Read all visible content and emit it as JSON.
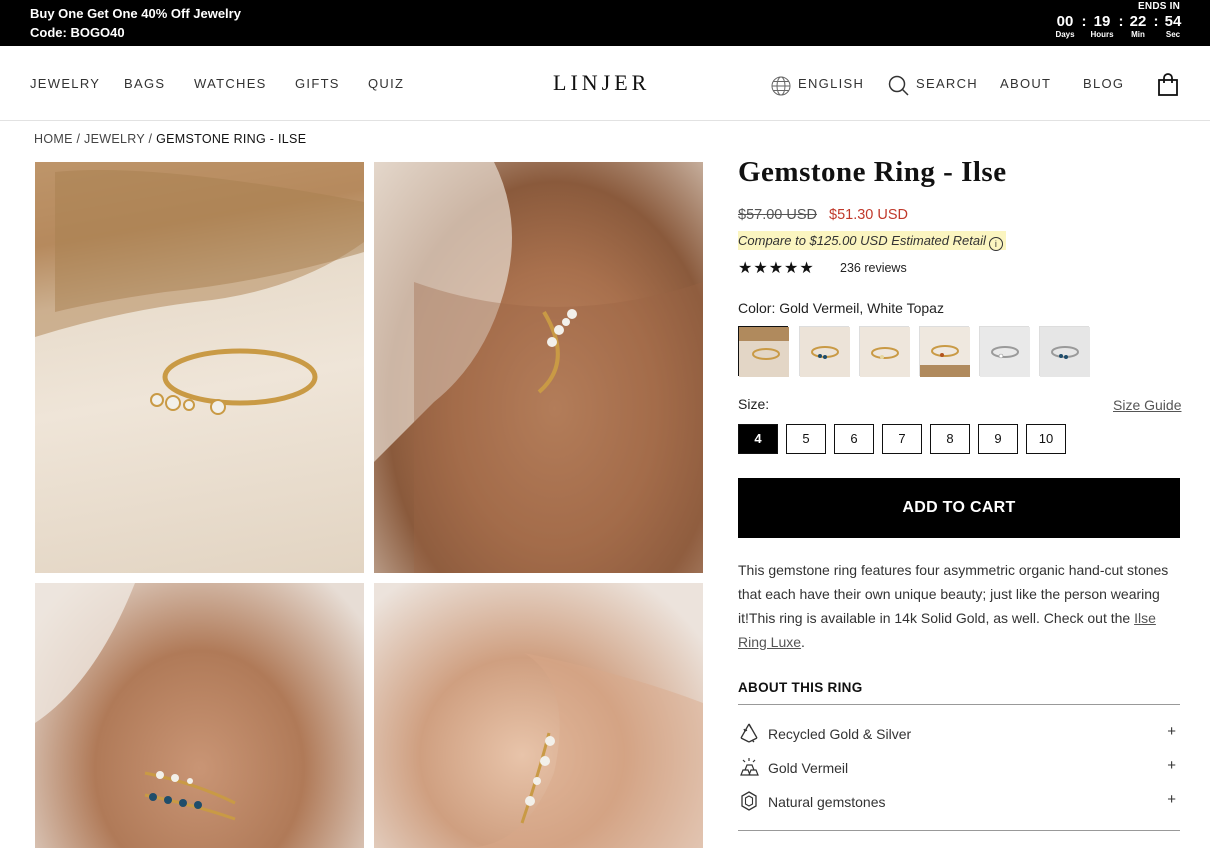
{
  "promo": {
    "line1": "Buy One Get One 40% Off Jewelry",
    "line2": "Code: BOGO40",
    "countdown": {
      "label": "ENDS IN",
      "days": "00",
      "days_label": "Days",
      "hours": "19",
      "hours_label": "Hours",
      "mins": "22",
      "mins_label": "Min",
      "secs": "54",
      "secs_label": "Sec"
    }
  },
  "nav": {
    "left": [
      "JEWELRY",
      "BAGS",
      "WATCHES",
      "GIFTS",
      "QUIZ"
    ],
    "logo": "LINJER",
    "language": "ENGLISH",
    "search": "SEARCH",
    "about": "ABOUT",
    "blog": "BLOG"
  },
  "breadcrumb": {
    "home": "HOME",
    "jewelry": "JEWELRY",
    "current": "GEMSTONE RING - ILSE",
    "sep": "/"
  },
  "product": {
    "title": "Gemstone Ring - Ilse",
    "old_price": "$57.00 USD",
    "price": "$51.30 USD",
    "compare": "Compare to $125.00 USD Estimated Retail",
    "stars": "★★★★★",
    "rating": 5,
    "reviews": "236 reviews",
    "color_label": "Color: Gold Vermeil, White Topaz",
    "swatch_count": 6,
    "size_label": "Size:",
    "size_guide": "Size Guide",
    "sizes": [
      "4",
      "5",
      "6",
      "7",
      "8",
      "9",
      "10"
    ],
    "selected_size": "4",
    "add_to_cart": "ADD TO CART",
    "description_1": "This gemstone ring features four asymmetric organic hand-cut stones that each have their own unique beauty; just like the person wearing it!This ring is available in 14k Solid Gold, as well. Check out the ",
    "description_link": "Ilse Ring Luxe",
    "description_2": ".",
    "about_heading": "ABOUT THIS RING",
    "features": [
      {
        "label": "Recycled Gold & Silver",
        "icon": "recycle-icon"
      },
      {
        "label": "Gold Vermeil",
        "icon": "gold-bars-icon"
      },
      {
        "label": "Natural gemstones",
        "icon": "gemstone-icon"
      }
    ],
    "plus": "+"
  },
  "colors": {
    "promo_bg": "#000000",
    "sale_price": "#c0392b",
    "compare_highlight": "#fbf5c0",
    "button_bg": "#000000"
  }
}
